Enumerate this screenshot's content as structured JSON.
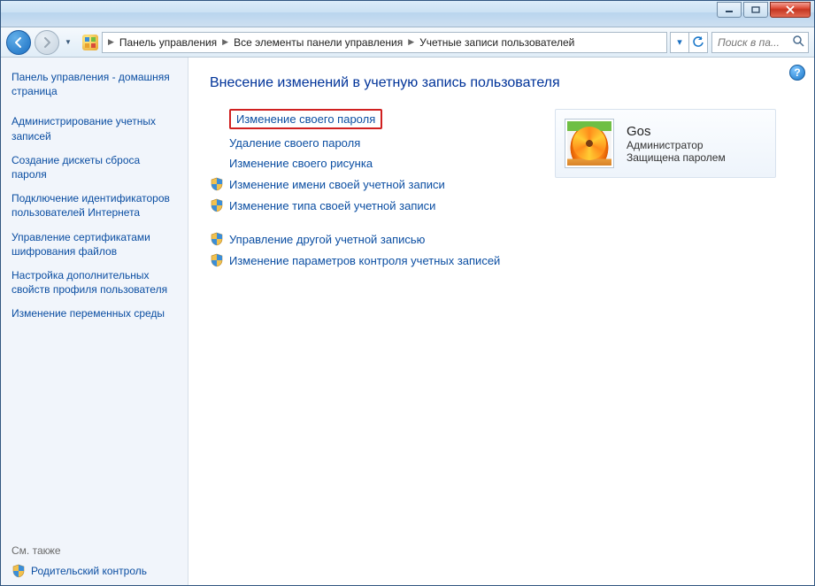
{
  "titlebar": {
    "minimize_icon": "minimize",
    "maximize_icon": "maximize",
    "close_icon": "close"
  },
  "breadcrumb": {
    "items": [
      "Панель управления",
      "Все элементы панели управления",
      "Учетные записи пользователей"
    ]
  },
  "search": {
    "placeholder": "Поиск в па..."
  },
  "sidebar": {
    "home": "Панель управления - домашняя страница",
    "links": [
      "Администрирование учетных записей",
      "Создание дискеты сброса пароля",
      "Подключение идентификаторов пользователей Интернета",
      "Управление сертификатами шифрования файлов",
      "Настройка дополнительных свойств профиля пользователя",
      "Изменение переменных среды"
    ],
    "see_also": "См. также",
    "parental": "Родительский контроль"
  },
  "content": {
    "title": "Внесение изменений в учетную запись пользователя",
    "group1": [
      {
        "label": "Изменение своего пароля",
        "shield": false,
        "highlight": true
      },
      {
        "label": "Удаление своего пароля",
        "shield": false,
        "highlight": false
      },
      {
        "label": "Изменение своего рисунка",
        "shield": false,
        "highlight": false
      },
      {
        "label": "Изменение имени своей учетной записи",
        "shield": true,
        "highlight": false
      },
      {
        "label": "Изменение типа своей учетной записи",
        "shield": true,
        "highlight": false
      }
    ],
    "group2": [
      {
        "label": "Управление другой учетной записью",
        "shield": true
      },
      {
        "label": "Изменение параметров контроля учетных записей",
        "shield": true
      }
    ],
    "user": {
      "name": "Gos",
      "role": "Администратор",
      "status": "Защищена паролем"
    }
  }
}
